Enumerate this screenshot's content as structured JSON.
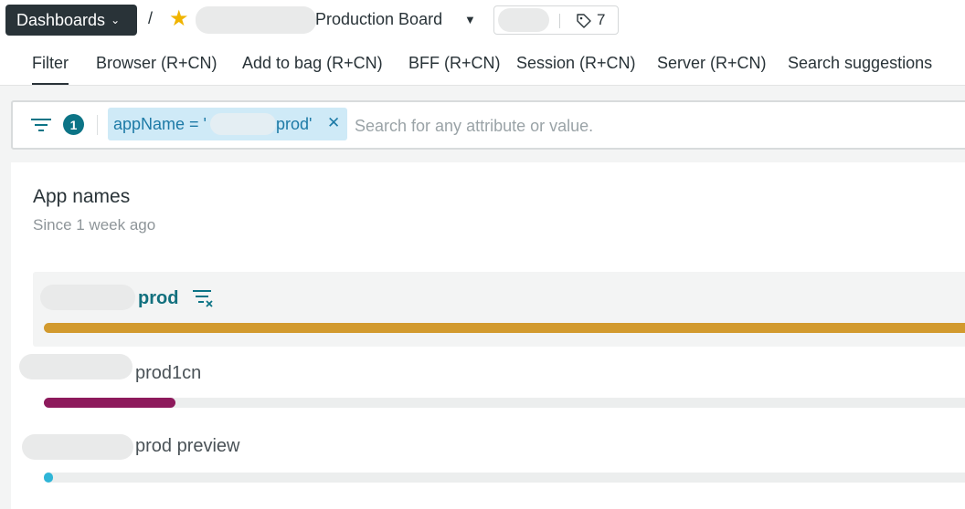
{
  "header": {
    "dashboards_label": "Dashboards",
    "breadcrumb_separator": "/",
    "dashboard_title": "Production Board",
    "tag_count": "7"
  },
  "tabs": [
    {
      "label": "Filter",
      "active": true
    },
    {
      "label": "Browser (R+CN)"
    },
    {
      "label": "Add to bag (R+CN)"
    },
    {
      "label": "BFF (R+CN)"
    },
    {
      "label": "Session (R+CN)"
    },
    {
      "label": "Server (R+CN)"
    },
    {
      "label": "Search suggestions"
    }
  ],
  "filter": {
    "active_count": "1",
    "chip_prefix": "appName = '",
    "chip_suffix": "prod'",
    "search_placeholder": "Search for any attribute or value."
  },
  "widget": {
    "title": "App names",
    "subtitle": "Since 1 week ago",
    "rows": [
      {
        "label": "prod",
        "share": 1.0,
        "color": "#d29a2e",
        "selected": true
      },
      {
        "label": "prod1cn",
        "share": 0.14,
        "color": "#8d1a5c"
      },
      {
        "label": "prod preview",
        "share": 0.01,
        "color": "#2fb5d7"
      }
    ]
  },
  "colors": {
    "accent": "#0c7486",
    "chip_bg": "#cfeaf7",
    "header_button": "#293338",
    "star": "#f0b400"
  },
  "icons": [
    "chevron-down-icon",
    "star-icon",
    "tag-icon",
    "filter-lines-icon",
    "close-icon",
    "filter-remove-icon"
  ]
}
